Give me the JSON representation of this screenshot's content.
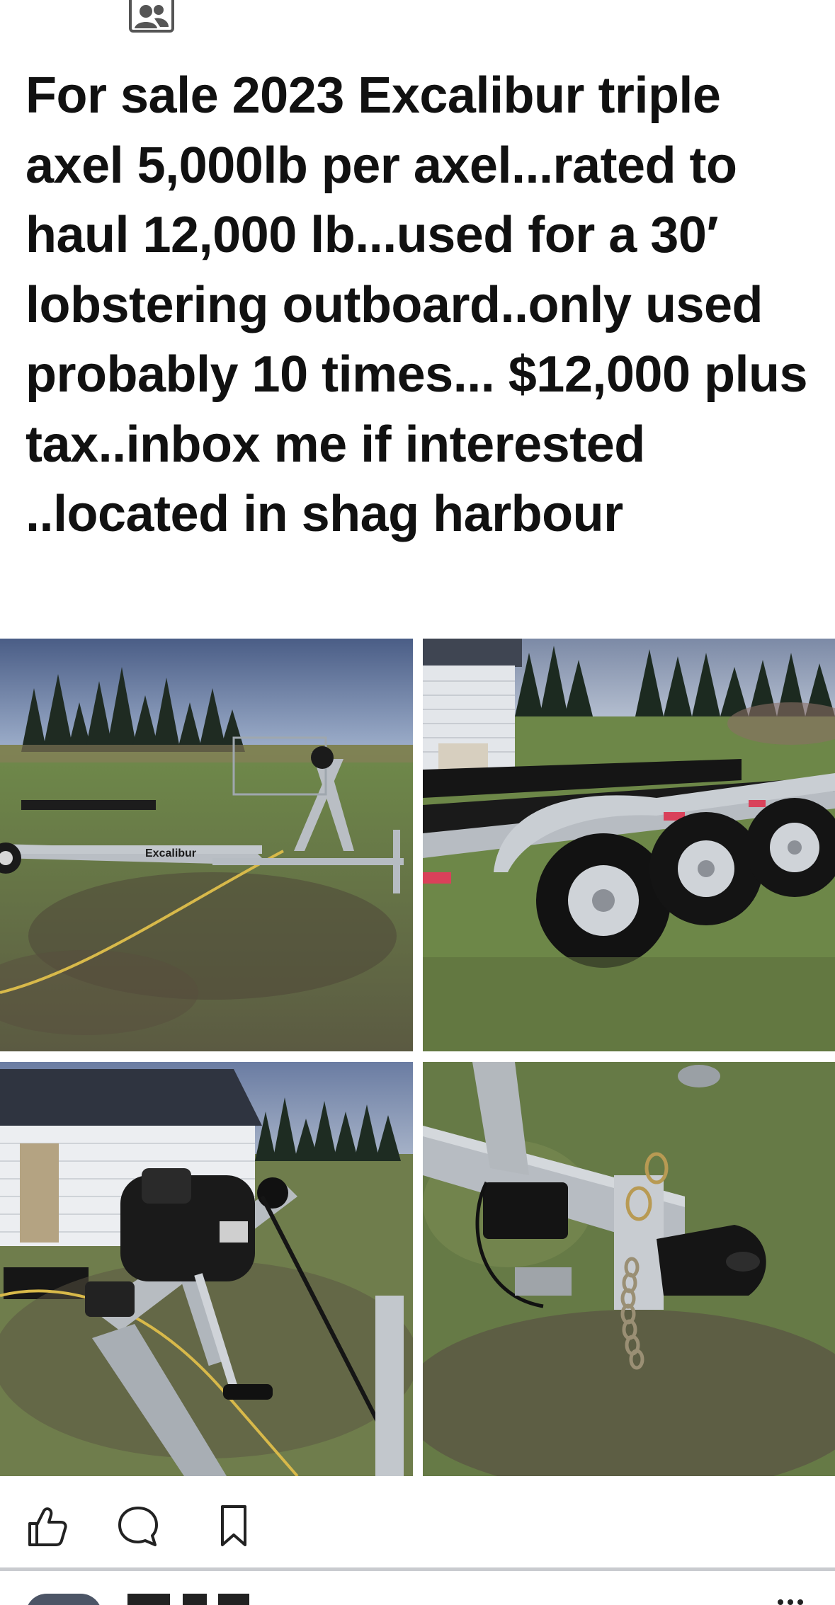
{
  "post": {
    "group_icon": "group-members-icon",
    "text": "For sale 2023 Excalibur triple axel 5,000lb per axel...rated to haul 12,000 lb...used for a 30′ lobstering outboard..only used probably 10 times... $12,000 plus tax..inbox me if interested ..located in shag harbour"
  },
  "photos": {
    "trailer_brand": "Excalibur"
  },
  "actions": {
    "like_icon": "thumbs-up-icon",
    "comment_icon": "comment-bubble-icon",
    "save_icon": "bookmark-icon"
  },
  "colors": {
    "text": "#111111",
    "divider": "#c9cbcf",
    "icon": "#222222"
  }
}
